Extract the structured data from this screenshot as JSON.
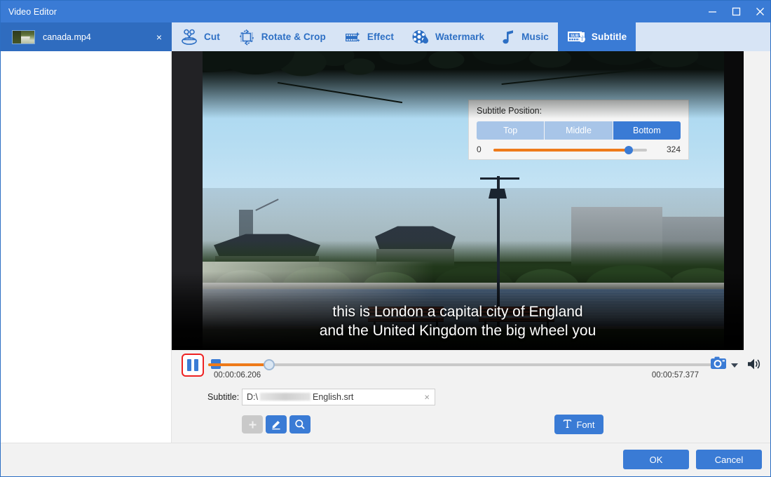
{
  "window": {
    "title": "Video Editor",
    "minimize_label": "minimize",
    "maximize_label": "maximize",
    "close_label": "close"
  },
  "file_tab": {
    "name": "canada.mp4",
    "close_label": "×"
  },
  "toolbar": {
    "items": [
      {
        "label": "Cut",
        "icon": "scissors-icon",
        "active": false
      },
      {
        "label": "Rotate & Crop",
        "icon": "rotate-crop-icon",
        "active": false
      },
      {
        "label": "Effect",
        "icon": "effect-icon",
        "active": false
      },
      {
        "label": "Watermark",
        "icon": "watermark-icon",
        "active": false
      },
      {
        "label": "Music",
        "icon": "music-note-icon",
        "active": false
      },
      {
        "label": "Subtitle",
        "icon": "subtitle-icon",
        "active": true
      }
    ]
  },
  "preview": {
    "subtitle_line1": "this is London a capital city of England",
    "subtitle_line2": "and the United Kingdom the big wheel you"
  },
  "player": {
    "state": "playing",
    "pause_label": "Pause",
    "stop_label": "Stop",
    "current_time": "00:00:06.206",
    "total_time": "00:00:57.377",
    "progress_percent": 11.8,
    "snapshot_label": "Snapshot",
    "volume_label": "Volume"
  },
  "subtitle_settings": {
    "label": "Subtitle:",
    "path_prefix": "D:\\",
    "path_suffix": "English.srt",
    "clear_label": "×",
    "add_label": "+",
    "edit_label": "Edit",
    "search_label": "Search",
    "font_label": "Font"
  },
  "position_panel": {
    "title": "Subtitle Position:",
    "options": [
      "Top",
      "Middle",
      "Bottom"
    ],
    "selected": "Bottom",
    "slider_min": "0",
    "slider_max": "324",
    "slider_percent": 88
  },
  "footer": {
    "ok_label": "OK",
    "cancel_label": "Cancel"
  },
  "colors": {
    "titlebar": "#3a7bd5",
    "accent_blue": "#3a7bd5",
    "toolbar_bg": "#d7e4f5",
    "slider_orange": "#ee7a1a",
    "highlight_red": "#ee2222",
    "segment_inactive": "#a8c5e8"
  }
}
